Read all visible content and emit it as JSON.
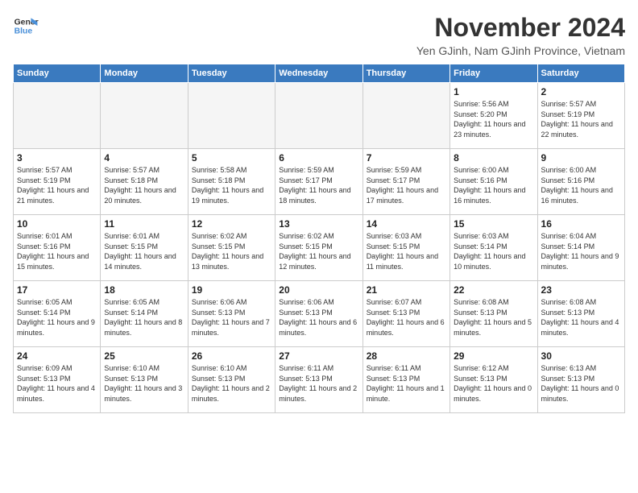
{
  "logo": {
    "line1": "General",
    "line2": "Blue"
  },
  "title": "November 2024",
  "location": "Yen GJinh, Nam GJinh Province, Vietnam",
  "weekdays": [
    "Sunday",
    "Monday",
    "Tuesday",
    "Wednesday",
    "Thursday",
    "Friday",
    "Saturday"
  ],
  "weeks": [
    [
      {
        "day": "",
        "info": ""
      },
      {
        "day": "",
        "info": ""
      },
      {
        "day": "",
        "info": ""
      },
      {
        "day": "",
        "info": ""
      },
      {
        "day": "",
        "info": ""
      },
      {
        "day": "1",
        "info": "Sunrise: 5:56 AM\nSunset: 5:20 PM\nDaylight: 11 hours and 23 minutes."
      },
      {
        "day": "2",
        "info": "Sunrise: 5:57 AM\nSunset: 5:19 PM\nDaylight: 11 hours and 22 minutes."
      }
    ],
    [
      {
        "day": "3",
        "info": "Sunrise: 5:57 AM\nSunset: 5:19 PM\nDaylight: 11 hours and 21 minutes."
      },
      {
        "day": "4",
        "info": "Sunrise: 5:57 AM\nSunset: 5:18 PM\nDaylight: 11 hours and 20 minutes."
      },
      {
        "day": "5",
        "info": "Sunrise: 5:58 AM\nSunset: 5:18 PM\nDaylight: 11 hours and 19 minutes."
      },
      {
        "day": "6",
        "info": "Sunrise: 5:59 AM\nSunset: 5:17 PM\nDaylight: 11 hours and 18 minutes."
      },
      {
        "day": "7",
        "info": "Sunrise: 5:59 AM\nSunset: 5:17 PM\nDaylight: 11 hours and 17 minutes."
      },
      {
        "day": "8",
        "info": "Sunrise: 6:00 AM\nSunset: 5:16 PM\nDaylight: 11 hours and 16 minutes."
      },
      {
        "day": "9",
        "info": "Sunrise: 6:00 AM\nSunset: 5:16 PM\nDaylight: 11 hours and 16 minutes."
      }
    ],
    [
      {
        "day": "10",
        "info": "Sunrise: 6:01 AM\nSunset: 5:16 PM\nDaylight: 11 hours and 15 minutes."
      },
      {
        "day": "11",
        "info": "Sunrise: 6:01 AM\nSunset: 5:15 PM\nDaylight: 11 hours and 14 minutes."
      },
      {
        "day": "12",
        "info": "Sunrise: 6:02 AM\nSunset: 5:15 PM\nDaylight: 11 hours and 13 minutes."
      },
      {
        "day": "13",
        "info": "Sunrise: 6:02 AM\nSunset: 5:15 PM\nDaylight: 11 hours and 12 minutes."
      },
      {
        "day": "14",
        "info": "Sunrise: 6:03 AM\nSunset: 5:15 PM\nDaylight: 11 hours and 11 minutes."
      },
      {
        "day": "15",
        "info": "Sunrise: 6:03 AM\nSunset: 5:14 PM\nDaylight: 11 hours and 10 minutes."
      },
      {
        "day": "16",
        "info": "Sunrise: 6:04 AM\nSunset: 5:14 PM\nDaylight: 11 hours and 9 minutes."
      }
    ],
    [
      {
        "day": "17",
        "info": "Sunrise: 6:05 AM\nSunset: 5:14 PM\nDaylight: 11 hours and 9 minutes."
      },
      {
        "day": "18",
        "info": "Sunrise: 6:05 AM\nSunset: 5:14 PM\nDaylight: 11 hours and 8 minutes."
      },
      {
        "day": "19",
        "info": "Sunrise: 6:06 AM\nSunset: 5:13 PM\nDaylight: 11 hours and 7 minutes."
      },
      {
        "day": "20",
        "info": "Sunrise: 6:06 AM\nSunset: 5:13 PM\nDaylight: 11 hours and 6 minutes."
      },
      {
        "day": "21",
        "info": "Sunrise: 6:07 AM\nSunset: 5:13 PM\nDaylight: 11 hours and 6 minutes."
      },
      {
        "day": "22",
        "info": "Sunrise: 6:08 AM\nSunset: 5:13 PM\nDaylight: 11 hours and 5 minutes."
      },
      {
        "day": "23",
        "info": "Sunrise: 6:08 AM\nSunset: 5:13 PM\nDaylight: 11 hours and 4 minutes."
      }
    ],
    [
      {
        "day": "24",
        "info": "Sunrise: 6:09 AM\nSunset: 5:13 PM\nDaylight: 11 hours and 4 minutes."
      },
      {
        "day": "25",
        "info": "Sunrise: 6:10 AM\nSunset: 5:13 PM\nDaylight: 11 hours and 3 minutes."
      },
      {
        "day": "26",
        "info": "Sunrise: 6:10 AM\nSunset: 5:13 PM\nDaylight: 11 hours and 2 minutes."
      },
      {
        "day": "27",
        "info": "Sunrise: 6:11 AM\nSunset: 5:13 PM\nDaylight: 11 hours and 2 minutes."
      },
      {
        "day": "28",
        "info": "Sunrise: 6:11 AM\nSunset: 5:13 PM\nDaylight: 11 hours and 1 minute."
      },
      {
        "day": "29",
        "info": "Sunrise: 6:12 AM\nSunset: 5:13 PM\nDaylight: 11 hours and 0 minutes."
      },
      {
        "day": "30",
        "info": "Sunrise: 6:13 AM\nSunset: 5:13 PM\nDaylight: 11 hours and 0 minutes."
      }
    ]
  ]
}
